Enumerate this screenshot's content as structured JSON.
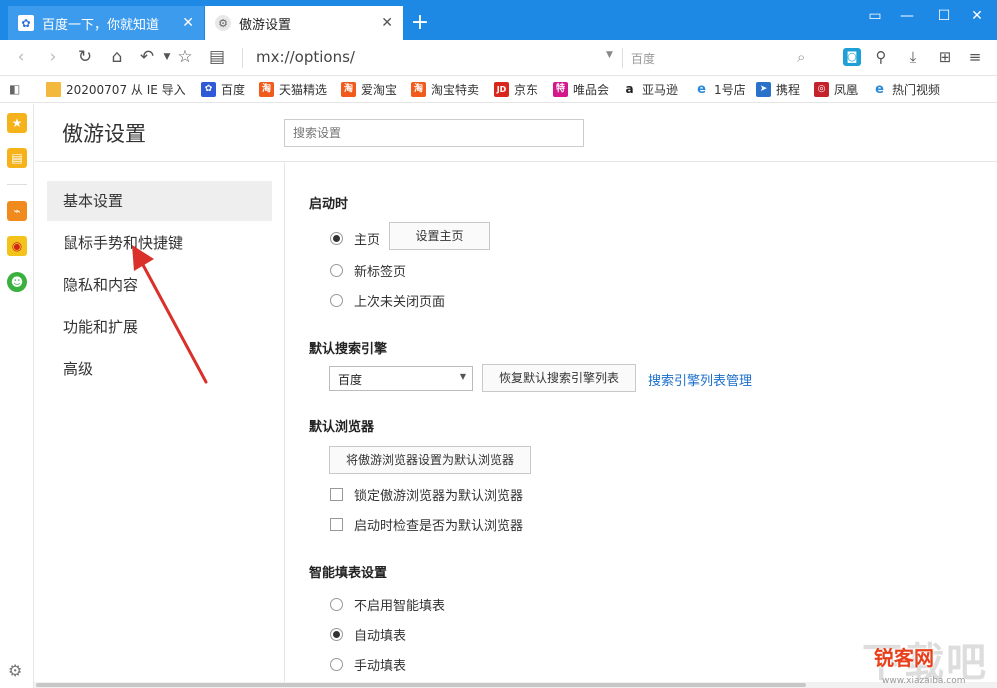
{
  "tabs": [
    {
      "title": "百度一下，你就知道",
      "favicon": "baidu-paw-icon",
      "active": false
    },
    {
      "title": "傲游设置",
      "favicon": "settings-gear-icon",
      "active": true
    }
  ],
  "toolbar": {
    "url": "mx://options/",
    "search_engine": "百度"
  },
  "bookmarks": [
    {
      "label": "20200707 从 IE 导入",
      "icon": "folder-icon",
      "color": "#f2b93c"
    },
    {
      "label": "百度",
      "icon": "baidu-paw-icon",
      "color": "#2f59d6"
    },
    {
      "label": "天猫精选",
      "icon": "taobao-icon",
      "color": "#f05a1a"
    },
    {
      "label": "爱淘宝",
      "icon": "taobao-icon",
      "color": "#f05a1a"
    },
    {
      "label": "淘宝特卖",
      "icon": "taobao-icon",
      "color": "#f05a1a"
    },
    {
      "label": "京东",
      "icon": "jd-icon",
      "color": "#d9261c"
    },
    {
      "label": "唯品会",
      "icon": "vip-icon",
      "color": "#d3198a"
    },
    {
      "label": "亚马逊",
      "icon": "amazon-icon",
      "color": "#222222"
    },
    {
      "label": "1号店",
      "icon": "ie-icon",
      "color": "#2a8ad8"
    },
    {
      "label": "携程",
      "icon": "ctrip-icon",
      "color": "#2a72c9"
    },
    {
      "label": "凤凰",
      "icon": "ifeng-icon",
      "color": "#c4232b"
    },
    {
      "label": "热门视频",
      "icon": "ie-icon",
      "color": "#2a8ad8"
    }
  ],
  "settings": {
    "title": "傲游设置",
    "search_placeholder": "搜索设置",
    "nav": [
      "基本设置",
      "鼠标手势和快捷键",
      "隐私和内容",
      "功能和扩展",
      "高级"
    ],
    "startup": {
      "title": "启动时",
      "options": [
        "主页",
        "新标签页",
        "上次未关闭页面"
      ],
      "selected": "主页",
      "set_home_button": "设置主页"
    },
    "search_engine": {
      "title": "默认搜索引擎",
      "selected": "百度",
      "restore_button": "恢复默认搜索引擎列表",
      "manage_link": "搜索引擎列表管理"
    },
    "default_browser": {
      "title": "默认浏览器",
      "set_button": "将傲游浏览器设置为默认浏览器",
      "lock_label": "锁定傲游浏览器为默认浏览器",
      "check_label": "启动时检查是否为默认浏览器"
    },
    "autofill": {
      "title": "智能填表设置",
      "options": [
        "不启用智能填表",
        "自动填表",
        "手动填表"
      ],
      "selected": "自动填表"
    }
  },
  "watermark": {
    "big": "下载吧",
    "badge": "锐客网",
    "url": "www.xiazaiba.com"
  }
}
